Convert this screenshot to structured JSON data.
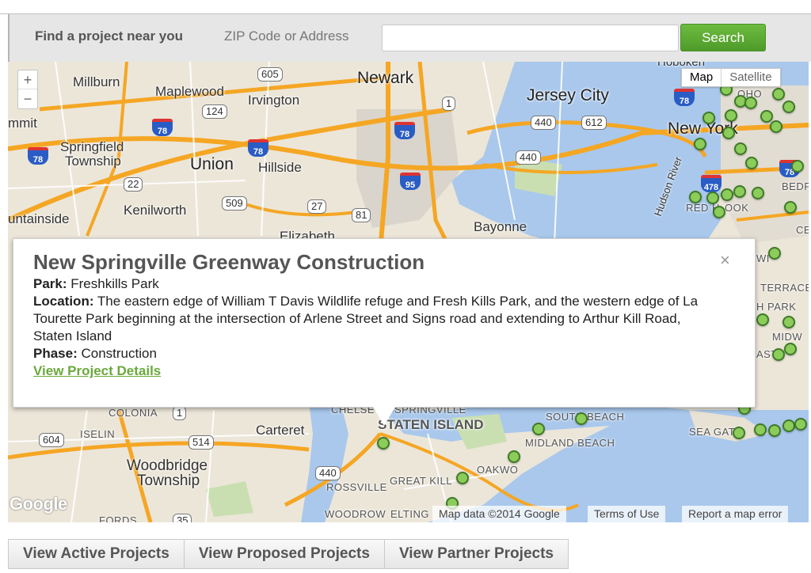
{
  "search": {
    "find_label": "Find a project near you",
    "zip_label": "ZIP Code or Address",
    "input_value": "",
    "button_label": "Search"
  },
  "map": {
    "zoom_in": "+",
    "zoom_out": "−",
    "type_map": "Map",
    "type_satellite": "Satellite",
    "places": {
      "newark": "Newark",
      "jersey_city": "Jersey City",
      "new_york": "New York",
      "millburn": "Millburn",
      "maplewood": "Maplewood",
      "irvington": "Irvington",
      "summit": "mmit",
      "springfield": "Springfield",
      "springfield_township": "Township",
      "union": "Union",
      "hillside": "Hillside",
      "mountainside": "untainside",
      "kenilworth": "Kenilworth",
      "elizabeth": "Elizabeth",
      "bayonne": "Bayonne",
      "hoboken": "Hoboken",
      "hudson_river": "Hudson River",
      "colonia": "COLONIA",
      "iselin": "ISELIN",
      "carteret": "Carteret",
      "woodbridge": "Woodbridge",
      "woodbridge_township": "Township",
      "staten_island": "STATEN ISLAND",
      "south_beach": "SOUTH BEACH",
      "midland_beach": "MIDLAND BEACH",
      "oakwood": "OAKWO",
      "great_kills": "GREAT KILL",
      "rossville": "ROSSVILLE",
      "woodrow": "WOODROW",
      "elting": "ELTING",
      "sea_gate": "SEA GAT",
      "chelsea": "CHELSE",
      "springville": "SPRINGVILLE",
      "red_hook": "RED H",
      "hook": "OOK",
      "soho": "OHO",
      "bed": "BEDF",
      "ford": "FORDS",
      "terrace": "TERRACE",
      "park": "H PARK",
      "midw": "MIDW",
      "east": "AST",
      "wi": "WI",
      "ce": "CE"
    },
    "shields": [
      "605",
      "124",
      "440",
      "612",
      "440",
      "22",
      "509",
      "27",
      "81",
      "604",
      "514",
      "440",
      "35",
      "1",
      "1"
    ],
    "interstates": [
      "78",
      "78",
      "78",
      "78",
      "95",
      "78",
      "478",
      "78"
    ],
    "attribution": {
      "data": "Map data ©2014 Google",
      "terms": "Terms of Use",
      "report": "Report a map error"
    },
    "logo": "Google"
  },
  "popup": {
    "title": "New Springville Greenway Construction",
    "park_label": "Park:",
    "park_value": "Freshkills Park",
    "location_label": "Location:",
    "location_value": "The eastern edge of William T Davis Wildlife refuge and Fresh Kills Park, and the western edge of La Tourette Park beginning at the intersection of Arlene Street and Signs road and extending to Arthur Kill Road, Staten Island",
    "phase_label": "Phase:",
    "phase_value": "Construction",
    "details_link": "View Project Details",
    "close": "×"
  },
  "tabs": {
    "active": "View Active Projects",
    "proposed": "View Proposed Projects",
    "partner": "View Partner Projects"
  },
  "colors": {
    "accent_green": "#6dbb3f",
    "marker_green": "#8ccc5a",
    "water": "#a9c8ec",
    "highway": "#f5a623"
  }
}
